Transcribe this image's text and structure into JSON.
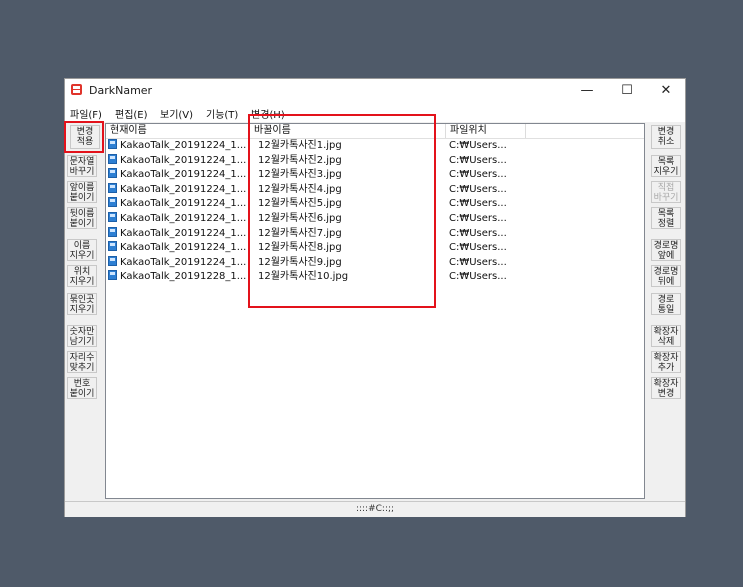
{
  "window": {
    "title": "DarkNamer",
    "minimize": "—",
    "maximize": "☐",
    "close": "✕"
  },
  "menu": [
    "파일(F)",
    "편집(E)",
    "보기(V)",
    "기능(T)",
    "변경(H)"
  ],
  "left_buttons": [
    {
      "line1": "변경",
      "line2": "적용"
    },
    {
      "line1": "문자열",
      "line2": "바꾸기"
    },
    {
      "line1": "앞이름",
      "line2": "붙이기"
    },
    {
      "line1": "뒷이름",
      "line2": "붙이기"
    },
    {
      "line1": "이름",
      "line2": "지우기"
    },
    {
      "line1": "위치",
      "line2": "지우기"
    },
    {
      "line1": "묶인곳",
      "line2": "지우기"
    },
    {
      "line1": "숫자만",
      "line2": "남기기"
    },
    {
      "line1": "자리수",
      "line2": "맞추기"
    },
    {
      "line1": "번호",
      "line2": "붙이기"
    }
  ],
  "right_buttons": [
    {
      "line1": "변경",
      "line2": "취소",
      "disabled": false
    },
    {
      "line1": "목록",
      "line2": "지우기",
      "disabled": false
    },
    {
      "line1": "직접",
      "line2": "바꾸기",
      "disabled": true
    },
    {
      "line1": "목록",
      "line2": "정렬",
      "disabled": false
    },
    {
      "line1": "경로명",
      "line2": "앞에",
      "disabled": false
    },
    {
      "line1": "경로명",
      "line2": "뒤에",
      "disabled": false
    },
    {
      "line1": "경로",
      "line2": "통일",
      "disabled": false
    },
    {
      "line1": "확장자",
      "line2": "삭제",
      "disabled": false
    },
    {
      "line1": "확장자",
      "line2": "추가",
      "disabled": false
    },
    {
      "line1": "확장자",
      "line2": "변경",
      "disabled": false
    }
  ],
  "columns": [
    "현재이름",
    "바꿀이름",
    "파일위치"
  ],
  "rows": [
    {
      "current": "KakaoTalk_20191224_1...",
      "new": "12월카톡사진1.jpg",
      "location": "C:₩Users..."
    },
    {
      "current": "KakaoTalk_20191224_1...",
      "new": "12월카톡사진2.jpg",
      "location": "C:₩Users..."
    },
    {
      "current": "KakaoTalk_20191224_1...",
      "new": "12월카톡사진3.jpg",
      "location": "C:₩Users..."
    },
    {
      "current": "KakaoTalk_20191224_1...",
      "new": "12월카톡사진4.jpg",
      "location": "C:₩Users..."
    },
    {
      "current": "KakaoTalk_20191224_1...",
      "new": "12월카톡사진5.jpg",
      "location": "C:₩Users..."
    },
    {
      "current": "KakaoTalk_20191224_1...",
      "new": "12월카톡사진6.jpg",
      "location": "C:₩Users..."
    },
    {
      "current": "KakaoTalk_20191224_1...",
      "new": "12월카톡사진7.jpg",
      "location": "C:₩Users..."
    },
    {
      "current": "KakaoTalk_20191224_1...",
      "new": "12월카톡사진8.jpg",
      "location": "C:₩Users..."
    },
    {
      "current": "KakaoTalk_20191224_1...",
      "new": "12월카톡사진9.jpg",
      "location": "C:₩Users..."
    },
    {
      "current": "KakaoTalk_20191228_1...",
      "new": "12월카톡사진10.jpg",
      "location": "C:₩Users..."
    }
  ],
  "status": "::::#C::;;",
  "colors": {
    "highlight": "#e3121b",
    "desktop": "#4f5a69",
    "icon": "#2d7fd3"
  }
}
